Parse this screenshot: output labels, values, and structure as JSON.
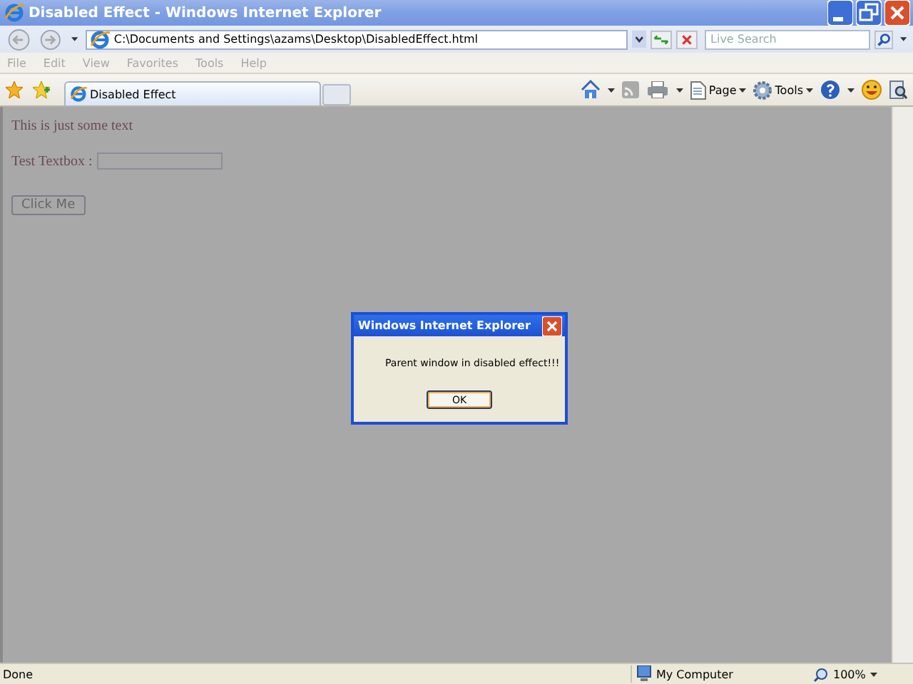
{
  "window": {
    "title": "Disabled Effect - Windows Internet Explorer"
  },
  "address_bar": {
    "value": "C:\\Documents and Settings\\azams\\Desktop\\DisabledEffect.html"
  },
  "search": {
    "placeholder": "Live Search"
  },
  "menu": [
    "File",
    "Edit",
    "View",
    "Favorites",
    "Tools",
    "Help"
  ],
  "tabs": [
    {
      "label": "Disabled Effect",
      "selected": true
    }
  ],
  "toolbar": {
    "page": "Page",
    "tools": "Tools"
  },
  "page": {
    "text": "This is just some text",
    "textbox_label": "Test Textbox :",
    "button": "Click Me"
  },
  "dialog": {
    "title": "Windows Internet Explorer",
    "message": "Parent window in disabled effect!!!",
    "button": "OK"
  },
  "status_bar": {
    "status": "Done",
    "zone": "My Computer",
    "zoom": "100%"
  }
}
